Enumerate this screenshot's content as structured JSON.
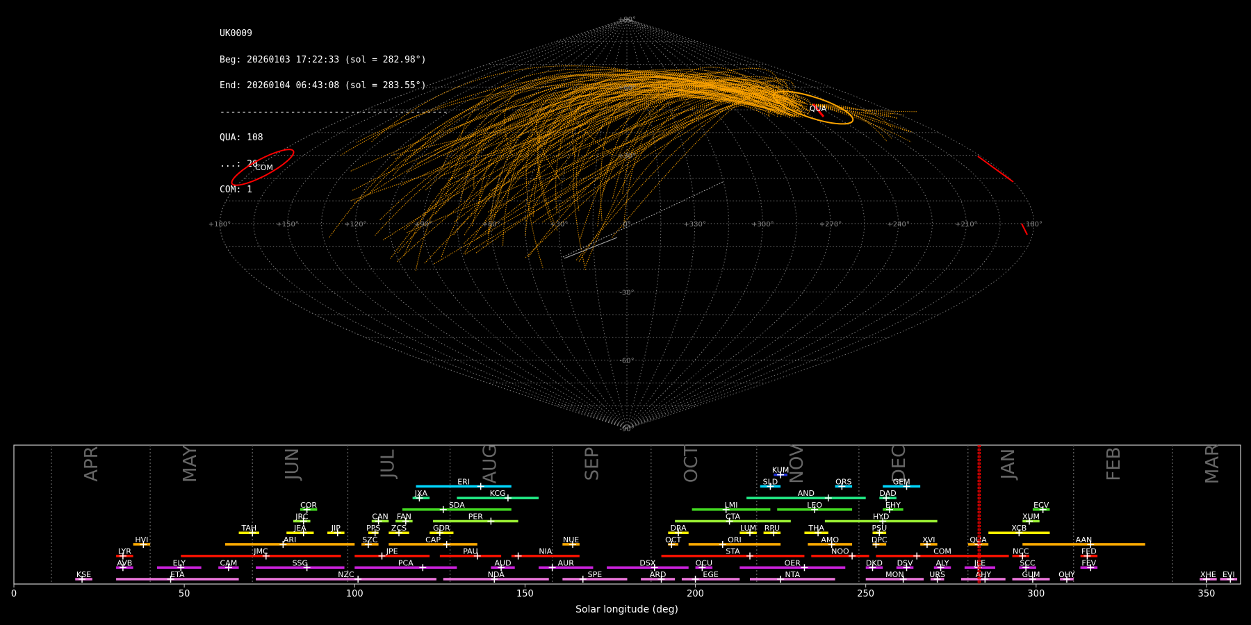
{
  "header": {
    "station": "UK0009",
    "begin": "Beg: 20260103 17:22:33 (sol = 282.98°)",
    "end": "End: 20260104 06:43:08 (sol = 283.55°)",
    "separator": "------------------------------------------",
    "counts": [
      {
        "text": "QUA: 108"
      },
      {
        "text": "...: 20"
      },
      {
        "text": "COM: 1"
      }
    ]
  },
  "sky_map": {
    "projection": "sinusoidal",
    "lat_labels": [
      "+90°",
      "+60°",
      "+30°",
      "0°",
      "-30°",
      "-60°",
      "-90°"
    ],
    "lon_labels": [
      "+180°",
      "+150°",
      "+120°",
      "+90°",
      "+60°",
      "+30°",
      "0°",
      "+330°",
      "+300°",
      "+270°",
      "+240°",
      "+210°",
      "180°"
    ],
    "radiant_labels": [
      "QUA",
      "COM"
    ],
    "colors": {
      "sporadic": "#ffa500",
      "shower": "#ff0000",
      "grid": "#777777"
    }
  },
  "chart_data": {
    "type": "timeline",
    "xlabel": "Solar longitude (deg)",
    "xlim": [
      0,
      360
    ],
    "xticks": [
      0,
      50,
      100,
      150,
      200,
      250,
      300,
      350
    ],
    "current_sol": [
      282.98,
      283.55
    ],
    "months": [
      {
        "name": "APR",
        "start": 11
      },
      {
        "name": "MAY",
        "start": 40
      },
      {
        "name": "JUN",
        "start": 70
      },
      {
        "name": "JUL",
        "start": 98
      },
      {
        "name": "AUG",
        "start": 128
      },
      {
        "name": "SEP",
        "start": 158
      },
      {
        "name": "OCT",
        "start": 187
      },
      {
        "name": "NOV",
        "start": 218
      },
      {
        "name": "DEC",
        "start": 248
      },
      {
        "name": "JAN",
        "start": 280
      },
      {
        "name": "FEB",
        "start": 311
      },
      {
        "name": "MAR",
        "start": 340
      }
    ],
    "showers": [
      {
        "code": "KUM",
        "start": 223,
        "end": 227,
        "peak": 225,
        "row": 9,
        "color": "#2233dd"
      },
      {
        "code": "ERI",
        "start": 118,
        "end": 146,
        "peak": 137,
        "row": 8,
        "color": "#00d8ff"
      },
      {
        "code": "SLD",
        "start": 219,
        "end": 225,
        "peak": 222,
        "row": 8,
        "color": "#00d8ff"
      },
      {
        "code": "ORS",
        "start": 241,
        "end": 246,
        "peak": 243,
        "row": 8,
        "color": "#00d8ff"
      },
      {
        "code": "GEM",
        "start": 255,
        "end": 266,
        "peak": 262,
        "row": 8,
        "color": "#00d8ff"
      },
      {
        "code": "JXA",
        "start": 117,
        "end": 122,
        "peak": 119,
        "row": 7,
        "color": "#22ee88"
      },
      {
        "code": "KCG",
        "start": 130,
        "end": 154,
        "peak": 145,
        "row": 7,
        "color": "#22ee88"
      },
      {
        "code": "AND",
        "start": 215,
        "end": 250,
        "peak": 239,
        "row": 7,
        "color": "#22ee88"
      },
      {
        "code": "DAD",
        "start": 254,
        "end": 259,
        "peak": 256,
        "row": 7,
        "color": "#22ee88"
      },
      {
        "code": "COR",
        "start": 84,
        "end": 89,
        "peak": 86,
        "row": 6,
        "color": "#44dd22"
      },
      {
        "code": "SDA",
        "start": 114,
        "end": 146,
        "peak": 126,
        "row": 6,
        "color": "#44dd22"
      },
      {
        "code": "LMI",
        "start": 199,
        "end": 222,
        "peak": 209,
        "row": 6,
        "color": "#44dd22"
      },
      {
        "code": "LEO",
        "start": 224,
        "end": 246,
        "peak": 235,
        "row": 6,
        "color": "#44dd22"
      },
      {
        "code": "EHY",
        "start": 255,
        "end": 261,
        "peak": 257,
        "row": 6,
        "color": "#44dd22"
      },
      {
        "code": "ECV",
        "start": 299,
        "end": 304,
        "peak": 302,
        "row": 6,
        "color": "#44dd22"
      },
      {
        "code": "JRC",
        "start": 82,
        "end": 87,
        "peak": 85,
        "row": 5,
        "color": "#99ee33"
      },
      {
        "code": "CAN",
        "start": 105,
        "end": 110,
        "peak": 107,
        "row": 5,
        "color": "#99ee33"
      },
      {
        "code": "FAN",
        "start": 112,
        "end": 117,
        "peak": 115,
        "row": 5,
        "color": "#99ee33"
      },
      {
        "code": "PER",
        "start": 123,
        "end": 148,
        "peak": 140,
        "row": 5,
        "color": "#99ee33"
      },
      {
        "code": "CTA",
        "start": 194,
        "end": 228,
        "peak": 210,
        "row": 5,
        "color": "#99ee33"
      },
      {
        "code": "HYD",
        "start": 238,
        "end": 271,
        "peak": 255,
        "row": 5,
        "color": "#99ee33"
      },
      {
        "code": "XUM",
        "start": 296,
        "end": 301,
        "peak": 298,
        "row": 5,
        "color": "#99ee33"
      },
      {
        "code": "TAH",
        "start": 66,
        "end": 72,
        "peak": 70,
        "row": 4,
        "color": "#ffee00"
      },
      {
        "code": "JEA",
        "start": 80,
        "end": 88,
        "peak": 85,
        "row": 4,
        "color": "#ffee00"
      },
      {
        "code": "JIP",
        "start": 92,
        "end": 97,
        "peak": 95,
        "row": 4,
        "color": "#ffee00"
      },
      {
        "code": "PPS",
        "start": 104,
        "end": 107,
        "peak": 106,
        "row": 4,
        "color": "#ffee00"
      },
      {
        "code": "ZCS",
        "start": 110,
        "end": 116,
        "peak": 113,
        "row": 4,
        "color": "#ffee00"
      },
      {
        "code": "GDR",
        "start": 122,
        "end": 129,
        "peak": 125,
        "row": 4,
        "color": "#ffee00"
      },
      {
        "code": "DRA",
        "start": 192,
        "end": 198,
        "peak": 195,
        "row": 4,
        "color": "#ffee00"
      },
      {
        "code": "LUM",
        "start": 213,
        "end": 218,
        "peak": 216,
        "row": 4,
        "color": "#ffee00"
      },
      {
        "code": "RPU",
        "start": 220,
        "end": 225,
        "peak": 223,
        "row": 4,
        "color": "#ffee00"
      },
      {
        "code": "THA",
        "start": 232,
        "end": 239,
        "peak": 236,
        "row": 4,
        "color": "#ffee00"
      },
      {
        "code": "PSU",
        "start": 252,
        "end": 256,
        "peak": 254,
        "row": 4,
        "color": "#ffee00"
      },
      {
        "code": "XCB",
        "start": 286,
        "end": 304,
        "peak": 295,
        "row": 4,
        "color": "#ffee00"
      },
      {
        "code": "HVI",
        "start": 35,
        "end": 40,
        "peak": 38,
        "row": 3,
        "color": "#ffaa00"
      },
      {
        "code": "ARI",
        "start": 62,
        "end": 100,
        "peak": 79,
        "row": 3,
        "color": "#ffaa00"
      },
      {
        "code": "SZC",
        "start": 102,
        "end": 107,
        "peak": 104,
        "row": 3,
        "color": "#ffaa00"
      },
      {
        "code": "CAP",
        "start": 110,
        "end": 136,
        "peak": 127,
        "row": 3,
        "color": "#ffaa00"
      },
      {
        "code": "NUE",
        "start": 161,
        "end": 166,
        "peak": 164,
        "row": 3,
        "color": "#ffaa00"
      },
      {
        "code": "OCT",
        "start": 192,
        "end": 195,
        "peak": 193,
        "row": 3,
        "color": "#ffaa00"
      },
      {
        "code": "ORI",
        "start": 198,
        "end": 225,
        "peak": 208,
        "row": 3,
        "color": "#ffaa00"
      },
      {
        "code": "AMO",
        "start": 233,
        "end": 246,
        "peak": 240,
        "row": 3,
        "color": "#ffaa00"
      },
      {
        "code": "DPC",
        "start": 252,
        "end": 256,
        "peak": 253,
        "row": 3,
        "color": "#ffaa00"
      },
      {
        "code": "XVI",
        "start": 266,
        "end": 271,
        "peak": 268,
        "row": 3,
        "color": "#ffaa00"
      },
      {
        "code": "QUA",
        "start": 280,
        "end": 286,
        "peak": 283,
        "row": 3,
        "color": "#ffaa00"
      },
      {
        "code": "AAN",
        "start": 296,
        "end": 332,
        "peak": 316,
        "row": 3,
        "color": "#ffaa00"
      },
      {
        "code": "LYR",
        "start": 30,
        "end": 35,
        "peak": 32,
        "row": 2,
        "color": "#ee1100"
      },
      {
        "code": "JMC",
        "start": 49,
        "end": 96,
        "peak": 74,
        "row": 2,
        "color": "#ee1100"
      },
      {
        "code": "JPE",
        "start": 100,
        "end": 122,
        "peak": 108,
        "row": 2,
        "color": "#ee1100"
      },
      {
        "code": "PAU",
        "start": 125,
        "end": 143,
        "peak": 136,
        "row": 2,
        "color": "#ee1100"
      },
      {
        "code": "NIA",
        "start": 146,
        "end": 166,
        "peak": 148,
        "row": 2,
        "color": "#ee1100"
      },
      {
        "code": "STA",
        "start": 190,
        "end": 232,
        "peak": 216,
        "row": 2,
        "color": "#ee1100"
      },
      {
        "code": "NOO",
        "start": 234,
        "end": 251,
        "peak": 246,
        "row": 2,
        "color": "#ee1100"
      },
      {
        "code": "COM",
        "start": 253,
        "end": 292,
        "peak": 265,
        "row": 2,
        "color": "#ee1100"
      },
      {
        "code": "NCC",
        "start": 293,
        "end": 298,
        "peak": 296,
        "row": 2,
        "color": "#ee1100"
      },
      {
        "code": "FED",
        "start": 313,
        "end": 318,
        "peak": 315,
        "row": 2,
        "color": "#ee1100"
      },
      {
        "code": "AVB",
        "start": 30,
        "end": 35,
        "peak": 32,
        "row": 1,
        "color": "#cc22dd"
      },
      {
        "code": "ELY",
        "start": 42,
        "end": 55,
        "peak": 49,
        "row": 1,
        "color": "#cc22dd"
      },
      {
        "code": "CAM",
        "start": 60,
        "end": 66,
        "peak": 63,
        "row": 1,
        "color": "#cc22dd"
      },
      {
        "code": "SSG",
        "start": 71,
        "end": 97,
        "peak": 86,
        "row": 1,
        "color": "#cc22dd"
      },
      {
        "code": "PCA",
        "start": 100,
        "end": 130,
        "peak": 120,
        "row": 1,
        "color": "#cc22dd"
      },
      {
        "code": "AUD",
        "start": 140,
        "end": 147,
        "peak": 143,
        "row": 1,
        "color": "#cc22dd"
      },
      {
        "code": "AUR",
        "start": 154,
        "end": 170,
        "peak": 158,
        "row": 1,
        "color": "#cc22dd"
      },
      {
        "code": "DSX",
        "start": 174,
        "end": 198,
        "peak": 188,
        "row": 1,
        "color": "#cc22dd"
      },
      {
        "code": "OCU",
        "start": 200,
        "end": 205,
        "peak": 202,
        "row": 1,
        "color": "#cc22dd"
      },
      {
        "code": "OER",
        "start": 213,
        "end": 244,
        "peak": 232,
        "row": 1,
        "color": "#cc22dd"
      },
      {
        "code": "DKD",
        "start": 250,
        "end": 255,
        "peak": 252,
        "row": 1,
        "color": "#cc22dd"
      },
      {
        "code": "DSV",
        "start": 259,
        "end": 264,
        "peak": 262,
        "row": 1,
        "color": "#cc22dd"
      },
      {
        "code": "ALY",
        "start": 270,
        "end": 275,
        "peak": 272,
        "row": 1,
        "color": "#cc22dd"
      },
      {
        "code": "JLE",
        "start": 279,
        "end": 288,
        "peak": 283,
        "row": 1,
        "color": "#cc22dd"
      },
      {
        "code": "SCC",
        "start": 295,
        "end": 300,
        "peak": 297,
        "row": 1,
        "color": "#cc22dd"
      },
      {
        "code": "FEV",
        "start": 313,
        "end": 318,
        "peak": 316,
        "row": 1,
        "color": "#cc22dd"
      },
      {
        "code": "KSE",
        "start": 18,
        "end": 23,
        "peak": 20,
        "row": 0,
        "color": "#ee77dd"
      },
      {
        "code": "ETA",
        "start": 30,
        "end": 66,
        "peak": 46,
        "row": 0,
        "color": "#ee77dd"
      },
      {
        "code": "NZC",
        "start": 71,
        "end": 124,
        "peak": 101,
        "row": 0,
        "color": "#ee77dd"
      },
      {
        "code": "NDA",
        "start": 126,
        "end": 157,
        "peak": 141,
        "row": 0,
        "color": "#ee77dd"
      },
      {
        "code": "SPE",
        "start": 161,
        "end": 180,
        "peak": 167,
        "row": 0,
        "color": "#ee77dd"
      },
      {
        "code": "ARD",
        "start": 184,
        "end": 194,
        "peak": 190,
        "row": 0,
        "color": "#ee77dd"
      },
      {
        "code": "EGE",
        "start": 196,
        "end": 213,
        "peak": 200,
        "row": 0,
        "color": "#ee77dd"
      },
      {
        "code": "NTA",
        "start": 216,
        "end": 241,
        "peak": 225,
        "row": 0,
        "color": "#ee77dd"
      },
      {
        "code": "MON",
        "start": 250,
        "end": 267,
        "peak": 261,
        "row": 0,
        "color": "#ee77dd"
      },
      {
        "code": "URS",
        "start": 269,
        "end": 273,
        "peak": 271,
        "row": 0,
        "color": "#ee77dd"
      },
      {
        "code": "AHY",
        "start": 278,
        "end": 291,
        "peak": 285,
        "row": 0,
        "color": "#ee77dd"
      },
      {
        "code": "GUM",
        "start": 293,
        "end": 304,
        "peak": 299,
        "row": 0,
        "color": "#ee77dd"
      },
      {
        "code": "OHY",
        "start": 307,
        "end": 311,
        "peak": 309,
        "row": 0,
        "color": "#ee77dd"
      },
      {
        "code": "XHE",
        "start": 348,
        "end": 353,
        "peak": 350,
        "row": 0,
        "color": "#ee77dd"
      },
      {
        "code": "EVI",
        "start": 354,
        "end": 359,
        "peak": 357,
        "row": 0,
        "color": "#ee77dd"
      }
    ]
  }
}
